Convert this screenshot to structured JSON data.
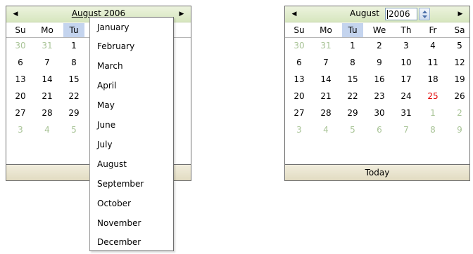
{
  "left_calendar": {
    "prev_icon": "triangle-left-icon",
    "next_icon": "triangle-right-icon",
    "month_label": "August",
    "year_label": "2006",
    "weekdays": [
      "Su",
      "Mo",
      "Tu"
    ],
    "days": [
      [
        "30",
        "31",
        "1"
      ],
      [
        "6",
        "7",
        "8"
      ],
      [
        "13",
        "14",
        "15"
      ],
      [
        "20",
        "21",
        "22"
      ],
      [
        "27",
        "28",
        "29"
      ],
      [
        "3",
        "4",
        "5"
      ]
    ]
  },
  "month_menu": {
    "items": [
      "January",
      "February",
      "March",
      "April",
      "May",
      "June",
      "July",
      "August",
      "September",
      "October",
      "November",
      "December"
    ]
  },
  "right_calendar": {
    "prev_icon": "triangle-left-icon",
    "next_icon": "triangle-right-icon",
    "month_label": "August",
    "year_value": "2006",
    "spin_icon": "spin-updown-icon",
    "weekdays": [
      "Su",
      "Mo",
      "Tu",
      "We",
      "Th",
      "Fr",
      "Sa"
    ],
    "days": [
      [
        "30",
        "31",
        "1",
        "2",
        "3",
        "4",
        "5"
      ],
      [
        "6",
        "7",
        "8",
        "9",
        "10",
        "11",
        "12"
      ],
      [
        "13",
        "14",
        "15",
        "16",
        "17",
        "18",
        "19"
      ],
      [
        "20",
        "21",
        "22",
        "23",
        "24",
        "25",
        "26"
      ],
      [
        "27",
        "28",
        "29",
        "30",
        "31",
        "1",
        "2"
      ],
      [
        "3",
        "4",
        "5",
        "6",
        "7",
        "8",
        "9"
      ]
    ],
    "today_label": "Today",
    "colors": {
      "today_day": "#e20000",
      "other_month_day": "#a9c497",
      "selected_weekday_bg": "#c4d4ee"
    }
  }
}
